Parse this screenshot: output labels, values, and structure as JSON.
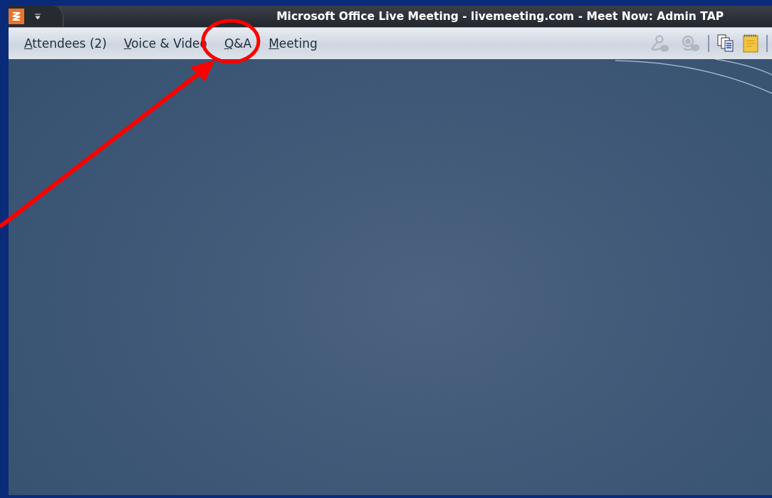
{
  "window": {
    "title": "Microsoft Office Live Meeting - livemeeting.com - Meet Now: Admin TAP"
  },
  "menu": [
    {
      "label": "Attendees (2)"
    },
    {
      "label": "Voice & Video"
    },
    {
      "label": "Q&A"
    },
    {
      "label": "Meeting"
    }
  ],
  "toolbar": [
    {
      "kind": "microphone",
      "disabled": true
    },
    {
      "kind": "webcam",
      "disabled": true
    },
    {
      "kind": "separator"
    },
    {
      "kind": "pages",
      "disabled": false
    },
    {
      "kind": "notepad",
      "disabled": false
    },
    {
      "kind": "separator"
    }
  ]
}
